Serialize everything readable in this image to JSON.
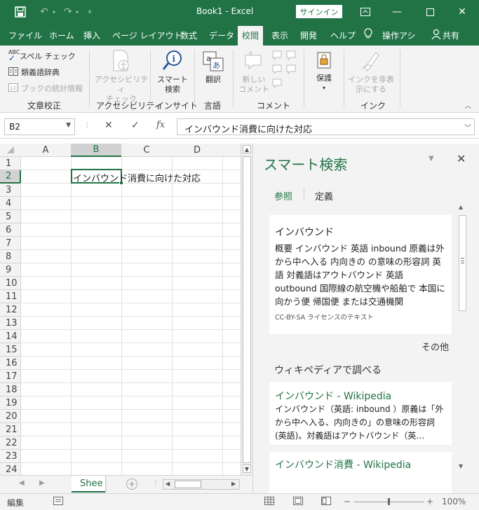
{
  "titlebar": {
    "title": "Book1  -  Excel",
    "signin_label": "サインイン",
    "quick_access": [
      "save-icon",
      "undo-icon",
      "redo-icon",
      "customize-icon"
    ],
    "window_controls": [
      "ribbon-display-icon",
      "minimize-icon",
      "maximize-icon",
      "close-icon"
    ]
  },
  "tabs": [
    {
      "label": "ファイル"
    },
    {
      "label": "ホーム"
    },
    {
      "label": "挿入"
    },
    {
      "label": "ページ レイアウト"
    },
    {
      "label": "数式"
    },
    {
      "label": "データ"
    },
    {
      "label": "校閲",
      "active": true
    },
    {
      "label": "表示"
    },
    {
      "label": "開発"
    },
    {
      "label": "ヘルプ"
    },
    {
      "label": "操作アシ"
    },
    {
      "label": "共有"
    }
  ],
  "ribbon": {
    "proofing": {
      "spell": "スペル チェック",
      "thesaurus": "類義語辞典",
      "stats": "ブックの統計情報",
      "label": "文章校正"
    },
    "accessibility": {
      "check_line1": "アクセシビリティ",
      "check_line2": "チェック",
      "label": "アクセシビリティ"
    },
    "insights": {
      "smart_line1": "スマート",
      "smart_line2": "検索",
      "label": "インサイト"
    },
    "language": {
      "translate": "翻訳",
      "label": "言語"
    },
    "comments": {
      "new_line1": "新しい",
      "new_line2": "コメント",
      "label": "コメント"
    },
    "protect": {
      "protect": "保護"
    },
    "ink": {
      "hide_line1": "インクを非表",
      "hide_line2": "示にする",
      "label": "インク"
    }
  },
  "formula_bar": {
    "name_box": "B2",
    "formula": "インバウンド消費に向けた対応"
  },
  "grid": {
    "columns": [
      "A",
      "B",
      "C",
      "D"
    ],
    "rows": [
      "1",
      "2",
      "3",
      "4",
      "5",
      "6",
      "7",
      "8",
      "9",
      "10",
      "11",
      "12",
      "13",
      "14",
      "15",
      "16",
      "17",
      "18",
      "19",
      "20",
      "21",
      "22",
      "23",
      "24"
    ],
    "active_cell": "B2",
    "cell_B2": "インバウンド消費に向けた対応"
  },
  "sheet": {
    "tab_label": "Shee"
  },
  "smart_lookup": {
    "title": "スマート検索",
    "tab_explore": "参照",
    "tab_define": "定義",
    "card": {
      "title": "インバウンド",
      "body": "概要 インバウンド 英語 inbound 原義は外から中へ入る 内向きの の意味の形容詞 英語 対義語はアウトバウンド 英語 outbound 国際線の航空機や船舶で 本国に向かう便 帰国便 または交通機関",
      "license": "CC-BY-SA ライセンスのテキスト"
    },
    "more": "その他",
    "wiki_heading": "ウィキペディアで調べる",
    "wiki_results": [
      {
        "title": "インバウンド - Wikipedia",
        "snippet": "インバウンド（英語: inbound ）原義は「外から中へ入る、内向きの」の意味の形容詞(英語)。対義語はアウトバウンド（英…"
      },
      {
        "title": "インバウンド消費 - Wikipedia",
        "snippet": ""
      }
    ]
  },
  "status": {
    "mode": "編集",
    "zoom": "100%",
    "zoom_level": 1.0
  },
  "colors": {
    "brand": "#217346",
    "ribbon_bg": "#f3f3f3"
  }
}
